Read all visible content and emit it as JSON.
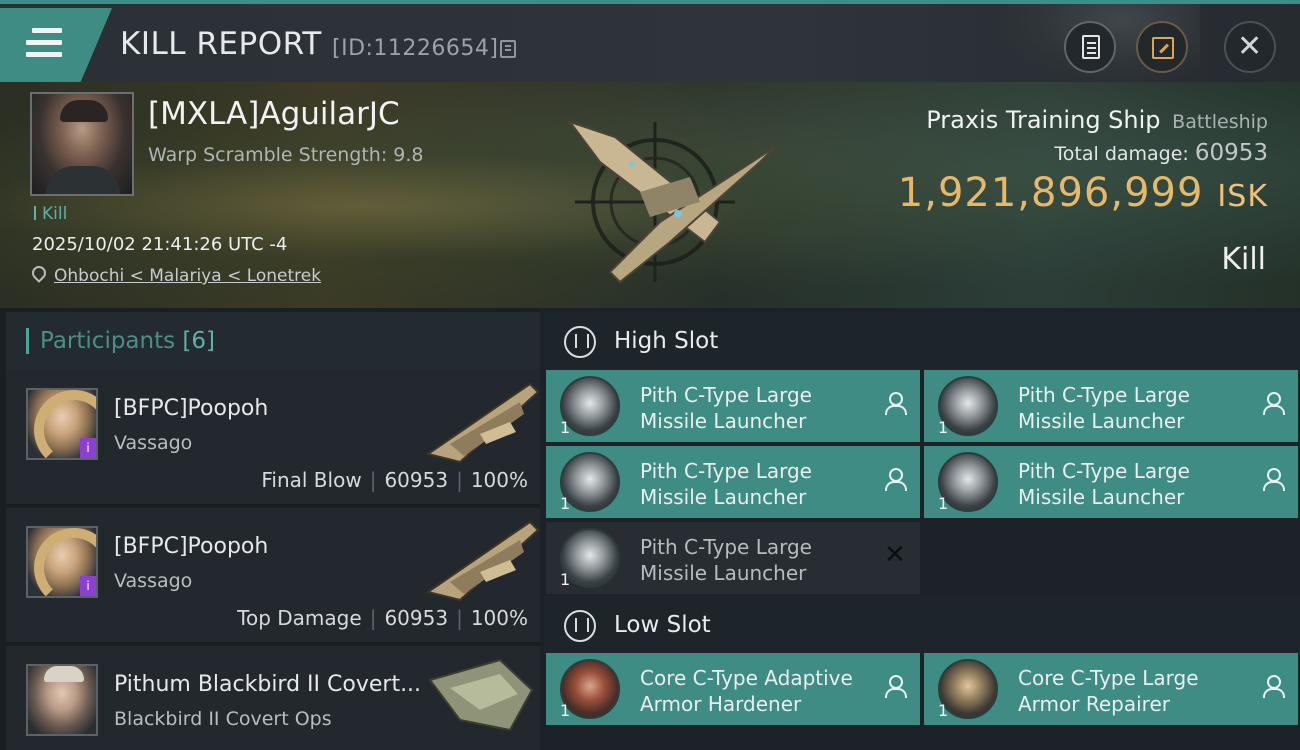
{
  "header": {
    "title": "KILL REPORT",
    "report_id": "[ID:11226654]",
    "icons": [
      "menu-icon",
      "copy-icon",
      "report-icon",
      "share-icon",
      "close-icon"
    ]
  },
  "victim": {
    "name": "[MXLA]AguilarJC",
    "warp_scramble": "Warp Scramble Strength: 9.8",
    "tag": "Kill",
    "datetime": "2025/10/02 21:41:26 UTC -4",
    "location": "Ohbochi < Malariya < Lonetrek",
    "ship_name": "Praxis Training Ship",
    "ship_class": "Battleship",
    "total_damage_label": "Total damage:",
    "total_damage": "60953",
    "isk_value": "1,921,896,999",
    "isk_unit": "ISK",
    "result": "Kill"
  },
  "participants": {
    "title": "Participants",
    "count": "[6]",
    "rows": [
      {
        "name": "[BFPC]Poopoh",
        "ship": "Vassago",
        "role": "Final Blow",
        "damage": "60953",
        "percent": "100%",
        "badge": "i"
      },
      {
        "name": "[BFPC]Poopoh",
        "ship": "Vassago",
        "role": "Top Damage",
        "damage": "60953",
        "percent": "100%",
        "badge": "i"
      },
      {
        "name": "Pithum Blackbird II Covert...",
        "ship": "Blackbird II Covert Ops"
      }
    ]
  },
  "fitting": {
    "high_slot_title": "High Slot",
    "low_slot_title": "Low Slot",
    "high_modules": [
      {
        "line1": "Pith C-Type Large",
        "line2": "Missile Launcher",
        "qty": "1",
        "status": "person-icon"
      },
      {
        "line1": "Pith C-Type Large",
        "line2": "Missile Launcher",
        "qty": "1",
        "status": "person-icon"
      },
      {
        "line1": "Pith C-Type Large",
        "line2": "Missile Launcher",
        "qty": "1",
        "status": "person-icon"
      },
      {
        "line1": "Pith C-Type Large",
        "line2": "Missile Launcher",
        "qty": "1",
        "status": "person-icon"
      },
      {
        "line1": "Pith C-Type Large",
        "line2": "Missile Launcher",
        "qty": "1",
        "status": "destroyed-x",
        "x": "✕"
      }
    ],
    "low_modules": [
      {
        "line1": "Core C-Type Adaptive",
        "line2": "Armor Hardener",
        "qty": "1",
        "status": "person-icon"
      },
      {
        "line1": "Core C-Type Large",
        "line2": "Armor Repairer",
        "qty": "1",
        "status": "person-icon"
      }
    ]
  },
  "colors": {
    "accent_teal": "#3f8c84",
    "isk_gold": "#e6b86a",
    "badge_purple": "#8b3fd4"
  }
}
